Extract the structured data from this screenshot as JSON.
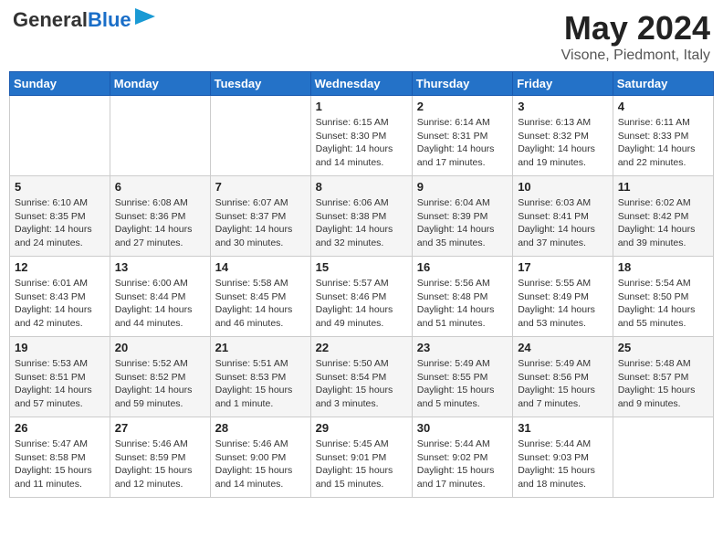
{
  "header": {
    "logo_line1": "General",
    "logo_line2": "Blue",
    "month_title": "May 2024",
    "location": "Visone, Piedmont, Italy"
  },
  "days_of_week": [
    "Sunday",
    "Monday",
    "Tuesday",
    "Wednesday",
    "Thursday",
    "Friday",
    "Saturday"
  ],
  "weeks": [
    [
      {
        "day": "",
        "info": ""
      },
      {
        "day": "",
        "info": ""
      },
      {
        "day": "",
        "info": ""
      },
      {
        "day": "1",
        "info": "Sunrise: 6:15 AM\nSunset: 8:30 PM\nDaylight: 14 hours and 14 minutes."
      },
      {
        "day": "2",
        "info": "Sunrise: 6:14 AM\nSunset: 8:31 PM\nDaylight: 14 hours and 17 minutes."
      },
      {
        "day": "3",
        "info": "Sunrise: 6:13 AM\nSunset: 8:32 PM\nDaylight: 14 hours and 19 minutes."
      },
      {
        "day": "4",
        "info": "Sunrise: 6:11 AM\nSunset: 8:33 PM\nDaylight: 14 hours and 22 minutes."
      }
    ],
    [
      {
        "day": "5",
        "info": "Sunrise: 6:10 AM\nSunset: 8:35 PM\nDaylight: 14 hours and 24 minutes."
      },
      {
        "day": "6",
        "info": "Sunrise: 6:08 AM\nSunset: 8:36 PM\nDaylight: 14 hours and 27 minutes."
      },
      {
        "day": "7",
        "info": "Sunrise: 6:07 AM\nSunset: 8:37 PM\nDaylight: 14 hours and 30 minutes."
      },
      {
        "day": "8",
        "info": "Sunrise: 6:06 AM\nSunset: 8:38 PM\nDaylight: 14 hours and 32 minutes."
      },
      {
        "day": "9",
        "info": "Sunrise: 6:04 AM\nSunset: 8:39 PM\nDaylight: 14 hours and 35 minutes."
      },
      {
        "day": "10",
        "info": "Sunrise: 6:03 AM\nSunset: 8:41 PM\nDaylight: 14 hours and 37 minutes."
      },
      {
        "day": "11",
        "info": "Sunrise: 6:02 AM\nSunset: 8:42 PM\nDaylight: 14 hours and 39 minutes."
      }
    ],
    [
      {
        "day": "12",
        "info": "Sunrise: 6:01 AM\nSunset: 8:43 PM\nDaylight: 14 hours and 42 minutes."
      },
      {
        "day": "13",
        "info": "Sunrise: 6:00 AM\nSunset: 8:44 PM\nDaylight: 14 hours and 44 minutes."
      },
      {
        "day": "14",
        "info": "Sunrise: 5:58 AM\nSunset: 8:45 PM\nDaylight: 14 hours and 46 minutes."
      },
      {
        "day": "15",
        "info": "Sunrise: 5:57 AM\nSunset: 8:46 PM\nDaylight: 14 hours and 49 minutes."
      },
      {
        "day": "16",
        "info": "Sunrise: 5:56 AM\nSunset: 8:48 PM\nDaylight: 14 hours and 51 minutes."
      },
      {
        "day": "17",
        "info": "Sunrise: 5:55 AM\nSunset: 8:49 PM\nDaylight: 14 hours and 53 minutes."
      },
      {
        "day": "18",
        "info": "Sunrise: 5:54 AM\nSunset: 8:50 PM\nDaylight: 14 hours and 55 minutes."
      }
    ],
    [
      {
        "day": "19",
        "info": "Sunrise: 5:53 AM\nSunset: 8:51 PM\nDaylight: 14 hours and 57 minutes."
      },
      {
        "day": "20",
        "info": "Sunrise: 5:52 AM\nSunset: 8:52 PM\nDaylight: 14 hours and 59 minutes."
      },
      {
        "day": "21",
        "info": "Sunrise: 5:51 AM\nSunset: 8:53 PM\nDaylight: 15 hours and 1 minute."
      },
      {
        "day": "22",
        "info": "Sunrise: 5:50 AM\nSunset: 8:54 PM\nDaylight: 15 hours and 3 minutes."
      },
      {
        "day": "23",
        "info": "Sunrise: 5:49 AM\nSunset: 8:55 PM\nDaylight: 15 hours and 5 minutes."
      },
      {
        "day": "24",
        "info": "Sunrise: 5:49 AM\nSunset: 8:56 PM\nDaylight: 15 hours and 7 minutes."
      },
      {
        "day": "25",
        "info": "Sunrise: 5:48 AM\nSunset: 8:57 PM\nDaylight: 15 hours and 9 minutes."
      }
    ],
    [
      {
        "day": "26",
        "info": "Sunrise: 5:47 AM\nSunset: 8:58 PM\nDaylight: 15 hours and 11 minutes."
      },
      {
        "day": "27",
        "info": "Sunrise: 5:46 AM\nSunset: 8:59 PM\nDaylight: 15 hours and 12 minutes."
      },
      {
        "day": "28",
        "info": "Sunrise: 5:46 AM\nSunset: 9:00 PM\nDaylight: 15 hours and 14 minutes."
      },
      {
        "day": "29",
        "info": "Sunrise: 5:45 AM\nSunset: 9:01 PM\nDaylight: 15 hours and 15 minutes."
      },
      {
        "day": "30",
        "info": "Sunrise: 5:44 AM\nSunset: 9:02 PM\nDaylight: 15 hours and 17 minutes."
      },
      {
        "day": "31",
        "info": "Sunrise: 5:44 AM\nSunset: 9:03 PM\nDaylight: 15 hours and 18 minutes."
      },
      {
        "day": "",
        "info": ""
      }
    ]
  ]
}
